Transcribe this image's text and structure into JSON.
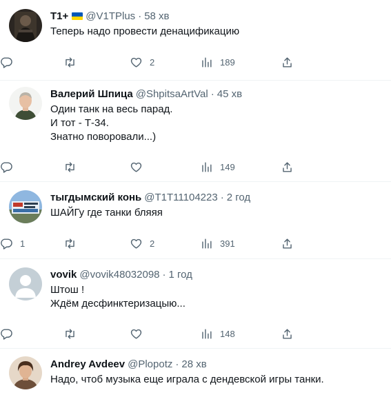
{
  "tweets": [
    {
      "name": "Т1+",
      "has_flag": true,
      "handle": "@V1TPlus",
      "time": "58 хв",
      "lines": [
        "Теперь надо провести денацификацию"
      ],
      "replies": "",
      "retweets": "",
      "likes": "2",
      "views": "189"
    },
    {
      "name": "Валерий Шпица",
      "handle": "@ShpitsaArtVal",
      "time": "45 хв",
      "lines": [
        "Один танк на весь парад.",
        "И тот - Т-34.",
        "Знатно поворовали...)"
      ],
      "replies": "",
      "retweets": "",
      "likes": "",
      "views": "149"
    },
    {
      "name": "тыгдымский конь",
      "handle": "@T1T11104223",
      "time": "2 год",
      "lines": [
        "ШАЙГу где танки бляяя"
      ],
      "replies": "1",
      "retweets": "",
      "likes": "2",
      "views": "391"
    },
    {
      "name": "vovik",
      "handle": "@vovik48032098",
      "time": "1 год",
      "lines": [
        "Штош !",
        "Ждём десфинктеризацыю..."
      ],
      "replies": "",
      "retweets": "",
      "likes": "",
      "views": "148"
    },
    {
      "name": "Andrey Avdeev",
      "handle": "@Plopotz",
      "time": "28 хв",
      "lines": [
        "Надо, чтоб музыка еще играла с дендевской игры танки."
      ]
    }
  ],
  "separator": "·",
  "icons": {
    "reply": "reply-icon",
    "retweet": "retweet-icon",
    "like": "like-icon",
    "views": "views-icon",
    "share": "share-icon"
  },
  "colors": {
    "text": "#0f1419",
    "secondary": "#536471",
    "divider": "#eff3f4"
  }
}
